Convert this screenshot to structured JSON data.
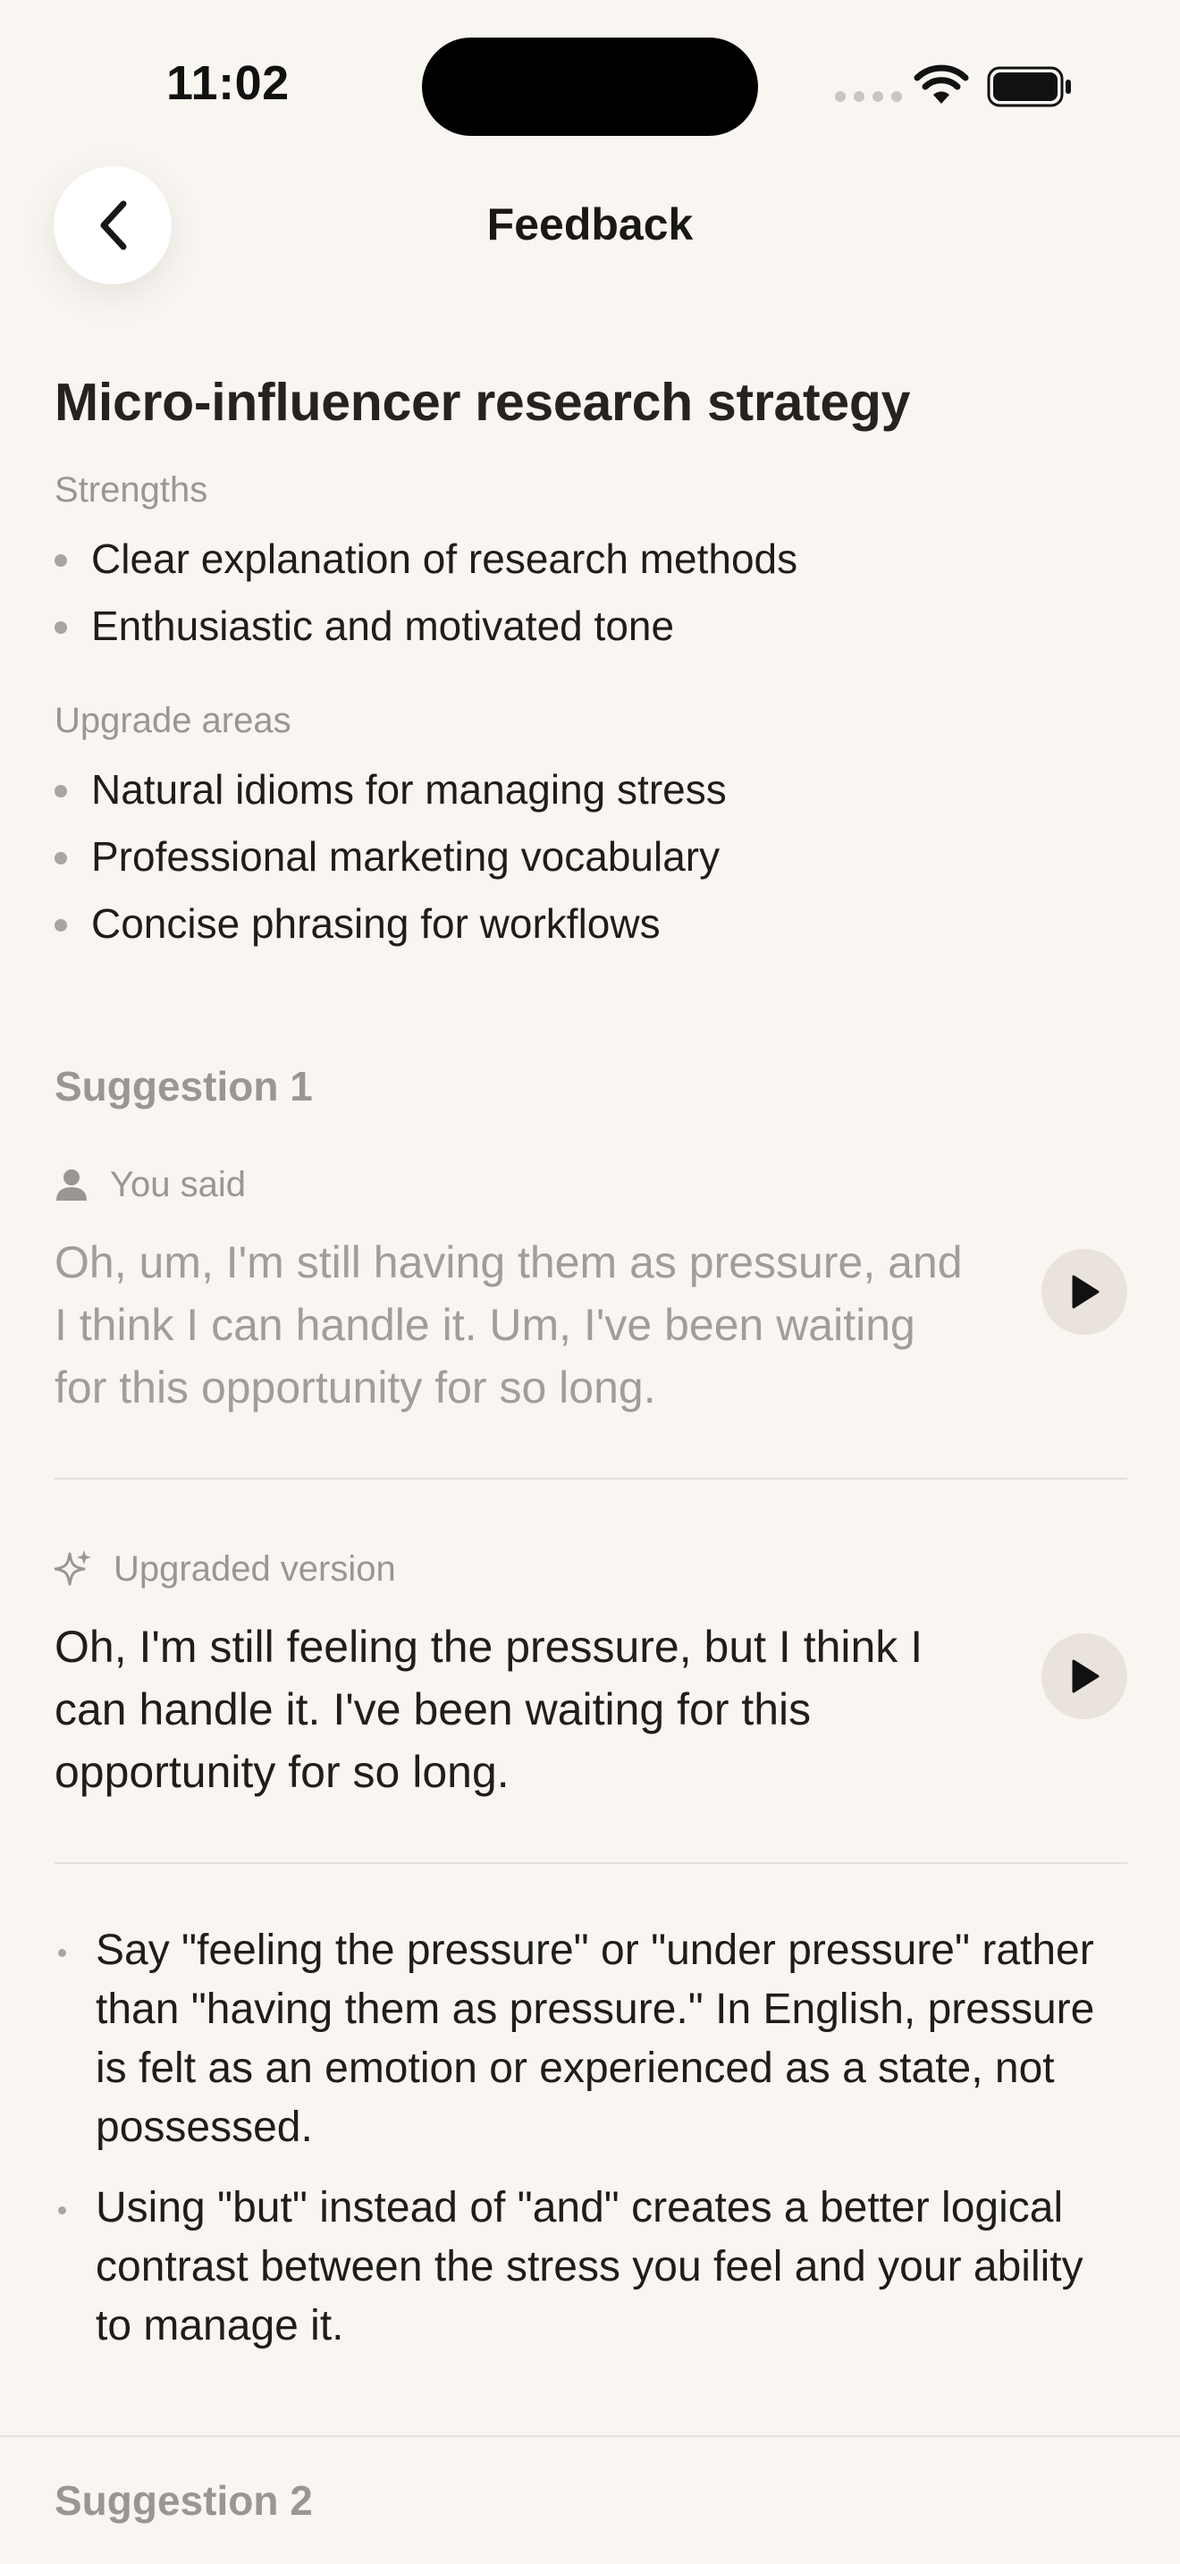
{
  "status_bar": {
    "time": "11:02"
  },
  "header": {
    "title": "Feedback"
  },
  "feedback": {
    "title": "Micro-influencer research strategy",
    "strengths_label": "Strengths",
    "strengths": [
      "Clear explanation of research methods",
      "Enthusiastic and motivated tone"
    ],
    "upgrade_label": "Upgrade areas",
    "upgrades": [
      "Natural idioms for managing stress",
      "Professional marketing vocabulary",
      "Concise phrasing for workflows"
    ]
  },
  "suggestion1": {
    "heading": "Suggestion 1",
    "you_said_label": "You said",
    "you_said_text": "Oh, um, I'm still having them as pressure, and I think I can handle it. Um, I've been waiting for this opportunity for so long.",
    "upgraded_label": "Upgraded version",
    "upgraded_text": "Oh, I'm still feeling the pressure, but I think I can handle it. I've been waiting for this opportunity for so long.",
    "notes": [
      "Say \"feeling the pressure\" or \"under pressure\" rather than \"having them as pressure.\" In English, pressure is felt as an emotion or experienced as a state, not possessed.",
      "Using \"but\" instead of \"and\" creates a better logical contrast between the stress you feel and your ability to manage it."
    ]
  },
  "suggestion2": {
    "heading": "Suggestion 2"
  },
  "icons": {
    "back": "chevron-left-icon",
    "user": "person-icon",
    "sparkle": "sparkle-icon",
    "play": "play-icon"
  }
}
